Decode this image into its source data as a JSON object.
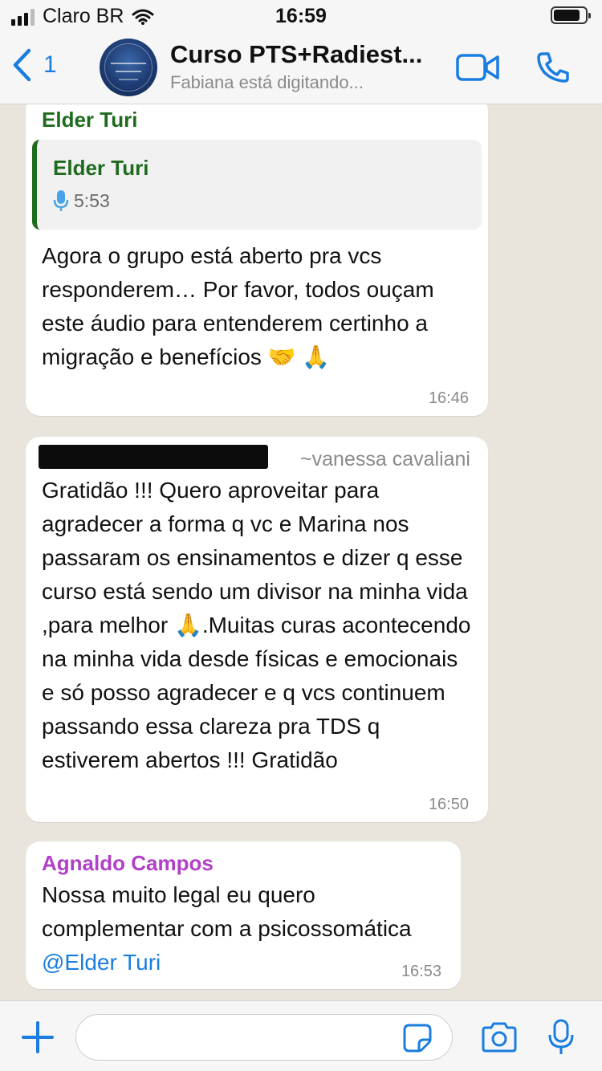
{
  "status_bar": {
    "carrier": "Claro BR",
    "time": "16:59"
  },
  "header": {
    "back_count": "1",
    "title": "Curso PTS+Radiest...",
    "subtitle": "Fabiana está digitando...",
    "avatar_lines": [
      "SUPER CURSO",
      "MESTRE DA",
      "PSICOSSOMÁTICA"
    ]
  },
  "messages": [
    {
      "sender": "Elder  Turi",
      "sender_color": "#1e6b1e",
      "quote": {
        "sender": "Elder  Turi",
        "audio_duration": "5:53"
      },
      "text": "Agora o grupo está aberto pra vcs responderem… Por favor, todos ouçam este áudio para entenderem certinho a migração e benefícios 🤝 🙏",
      "time": "16:46"
    },
    {
      "sender": "~vanessa cavaliani",
      "text": "Gratidão !!! Quero aproveitar para agradecer a forma q vc e Marina nos passaram os ensinamentos e dizer q esse curso está sendo um divisor na minha vida ,para melhor 🙏.Muitas curas acontecendo na minha vida desde físicas e emocionais e só posso agradecer e q vcs continuem passando essa clareza pra TDS q estiverem abertos  !!! Gratidão",
      "time": "16:50"
    },
    {
      "sender": "Agnaldo Campos",
      "sender_color": "#b23fc7",
      "text": "Nossa muito legal eu quero complementar com a psicossomática ",
      "mention": "@Elder  Turi",
      "time": "16:53"
    }
  ],
  "composer": {
    "placeholder": ""
  },
  "colors": {
    "accent": "#1a7de0",
    "chat_background": "#e9e4dc",
    "bubble": "#ffffff"
  },
  "icons": [
    "signal-icon",
    "wifi-icon",
    "battery-icon",
    "back-chevron-icon",
    "video-call-icon",
    "phone-icon",
    "microphone-icon",
    "plus-icon",
    "sticker-icon",
    "camera-icon"
  ]
}
